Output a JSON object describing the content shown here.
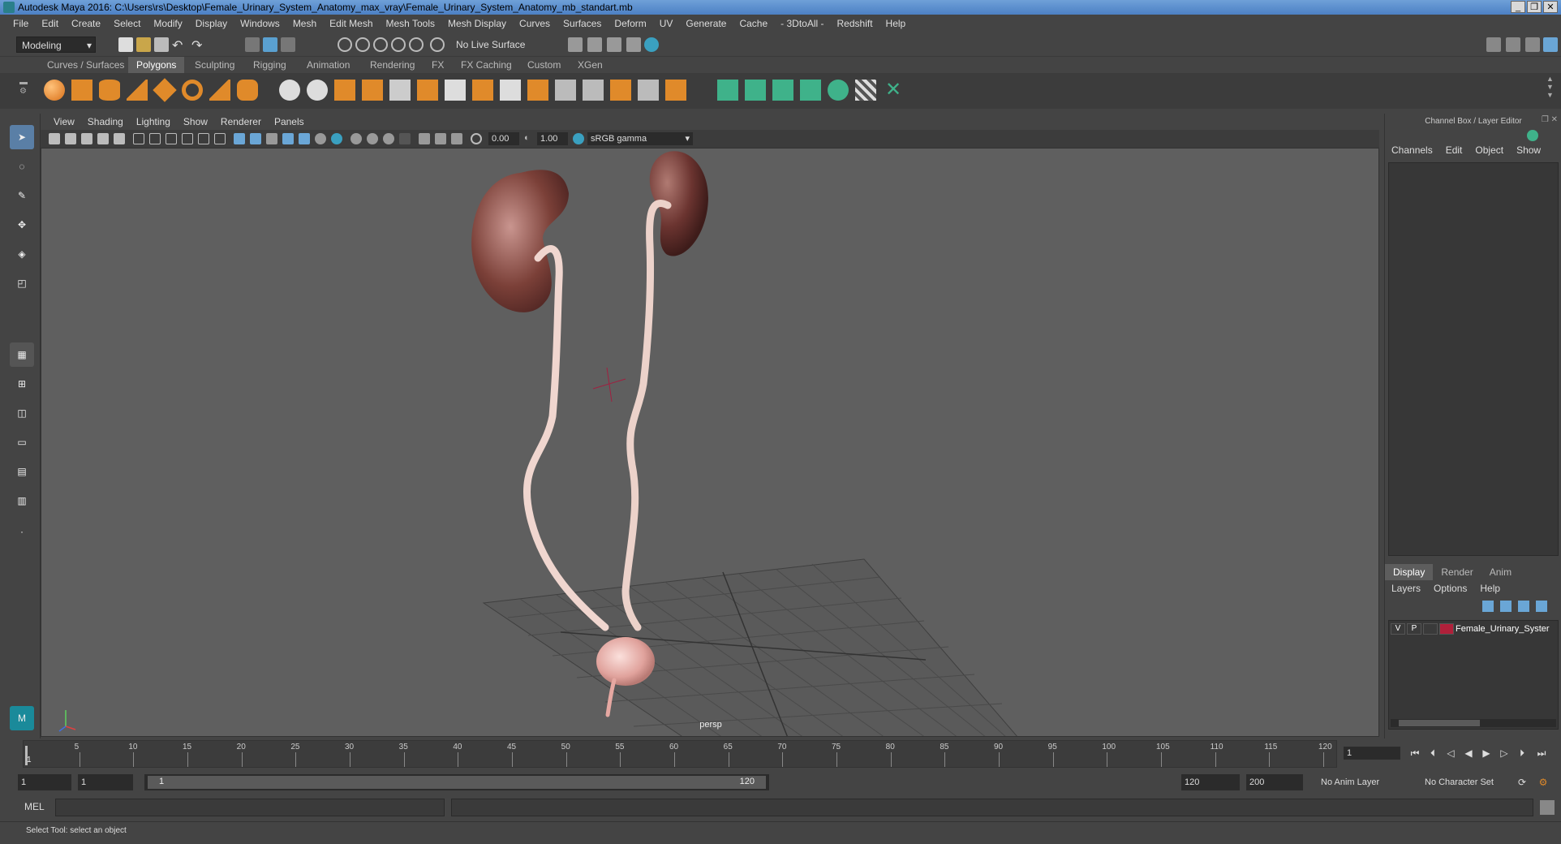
{
  "window": {
    "title": "Autodesk Maya 2016: C:\\Users\\rs\\Desktop\\Female_Urinary_System_Anatomy_max_vray\\Female_Urinary_System_Anatomy_mb_standart.mb",
    "controls": [
      "_",
      "❐",
      "✕"
    ]
  },
  "menubar": {
    "items": [
      "File",
      "Edit",
      "Create",
      "Select",
      "Modify",
      "Display",
      "Windows",
      "Mesh",
      "Edit Mesh",
      "Mesh Tools",
      "Mesh Display",
      "Curves",
      "Surfaces",
      "Deform",
      "UV",
      "Generate",
      "Cache",
      "- 3DtoAll -",
      "Redshift",
      "Help"
    ]
  },
  "statusline": {
    "mode": "Modeling",
    "live_surface": "No Live Surface"
  },
  "shelf": {
    "tabs": [
      "Curves / Surfaces",
      "Polygons",
      "Sculpting",
      "Rigging",
      "Animation",
      "Rendering",
      "FX",
      "FX Caching",
      "Custom",
      "XGen"
    ],
    "active_tab": "Polygons"
  },
  "viewport": {
    "menu": [
      "View",
      "Shading",
      "Lighting",
      "Show",
      "Renderer",
      "Panels"
    ],
    "exposure": "0.00",
    "gamma": "1.00",
    "color_space": "sRGB gamma",
    "camera_label": "persp"
  },
  "channel_box": {
    "title": "Channel Box / Layer Editor",
    "menu": [
      "Channels",
      "Edit",
      "Object",
      "Show"
    ]
  },
  "layer_editor": {
    "tabs": [
      "Display",
      "Render",
      "Anim"
    ],
    "active_tab": "Display",
    "menu": [
      "Layers",
      "Options",
      "Help"
    ],
    "layers": [
      {
        "v": "V",
        "p": "P",
        "name": "Female_Urinary_Syster",
        "color": "#b0203a"
      }
    ]
  },
  "timeline": {
    "ticks": [
      "5",
      "10",
      "15",
      "20",
      "25",
      "30",
      "35",
      "40",
      "45",
      "50",
      "55",
      "60",
      "65",
      "70",
      "75",
      "80",
      "85",
      "90",
      "95",
      "100",
      "105",
      "110",
      "115",
      "120"
    ],
    "start_marker": "1",
    "current_frame": "1"
  },
  "range": {
    "start": "1",
    "playback_start": "1",
    "slider_start": "1",
    "slider_end": "120",
    "playback_end": "120",
    "end": "200",
    "anim_layer": "No Anim Layer",
    "character_set": "No Character Set"
  },
  "command": {
    "label": "MEL"
  },
  "help_line": {
    "text": "Select Tool: select an object"
  }
}
